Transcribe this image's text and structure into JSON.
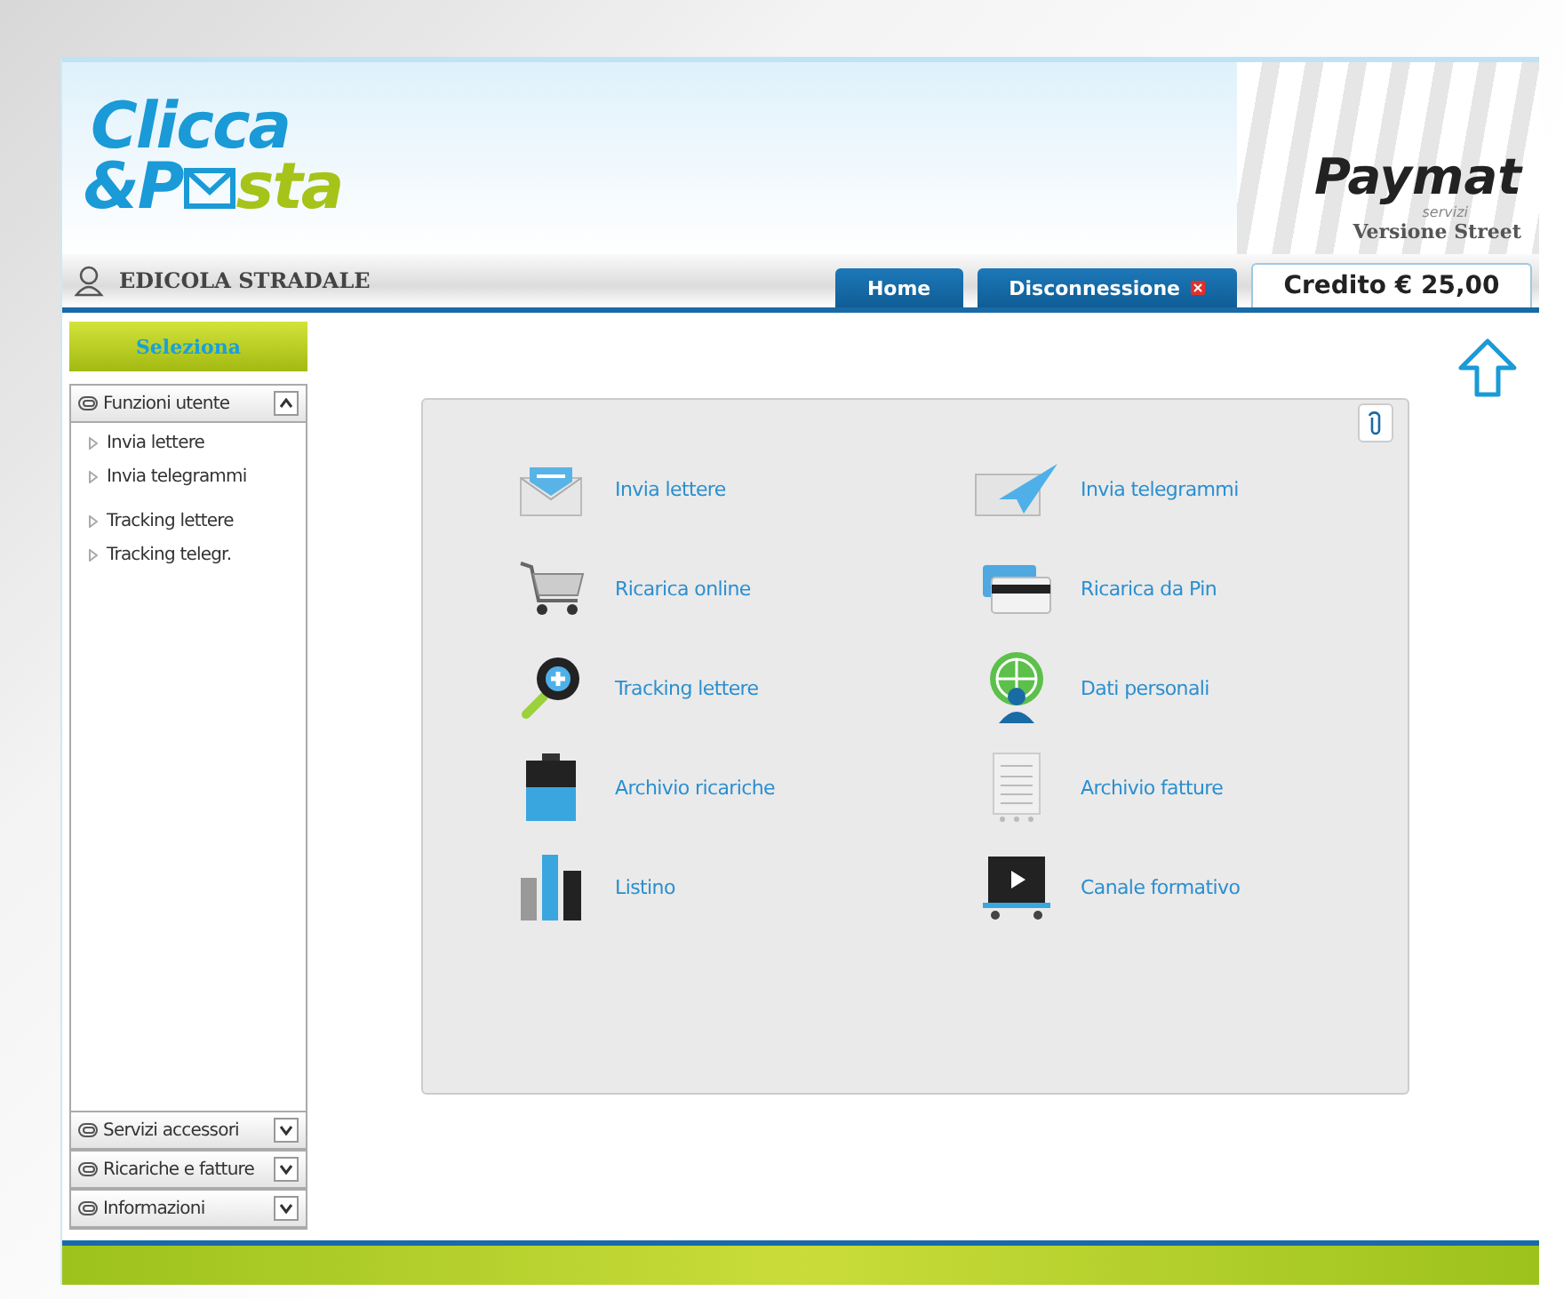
{
  "logo": {
    "line1": "Clicca",
    "line2_start": "&P",
    "line2_end": "sta"
  },
  "brand": {
    "name": "Paymat",
    "tagline": "servizi",
    "edition": "Versione Street"
  },
  "user": {
    "name": "EDICOLA STRADALE"
  },
  "tabs": [
    {
      "label": "Home",
      "kind": "tab"
    },
    {
      "label": "Disconnessione",
      "kind": "logout"
    }
  ],
  "credit": {
    "label": "Credito € 25,00"
  },
  "sidebar": {
    "select_button": "Seleziona",
    "sections": [
      {
        "title": "Funzioni utente",
        "expanded": true,
        "groups": [
          [
            "Invia lettere",
            "Invia telegrammi"
          ],
          [
            "Tracking lettere",
            "Tracking telegr."
          ]
        ]
      },
      {
        "title": "Servizi accessori",
        "expanded": false
      },
      {
        "title": "Ricariche e fatture",
        "expanded": false
      },
      {
        "title": "Informazioni",
        "expanded": false
      }
    ]
  },
  "functions": [
    {
      "label": "Invia lettere"
    },
    {
      "label": "Invia telegrammi"
    },
    {
      "label": "Ricarica online"
    },
    {
      "label": "Ricarica da Pin"
    },
    {
      "label": "Tracking lettere"
    },
    {
      "label": "Dati personali"
    },
    {
      "label": "Archivio ricariche"
    },
    {
      "label": "Archivio fatture"
    },
    {
      "label": "Listino"
    },
    {
      "label": "Canale formativo"
    }
  ]
}
